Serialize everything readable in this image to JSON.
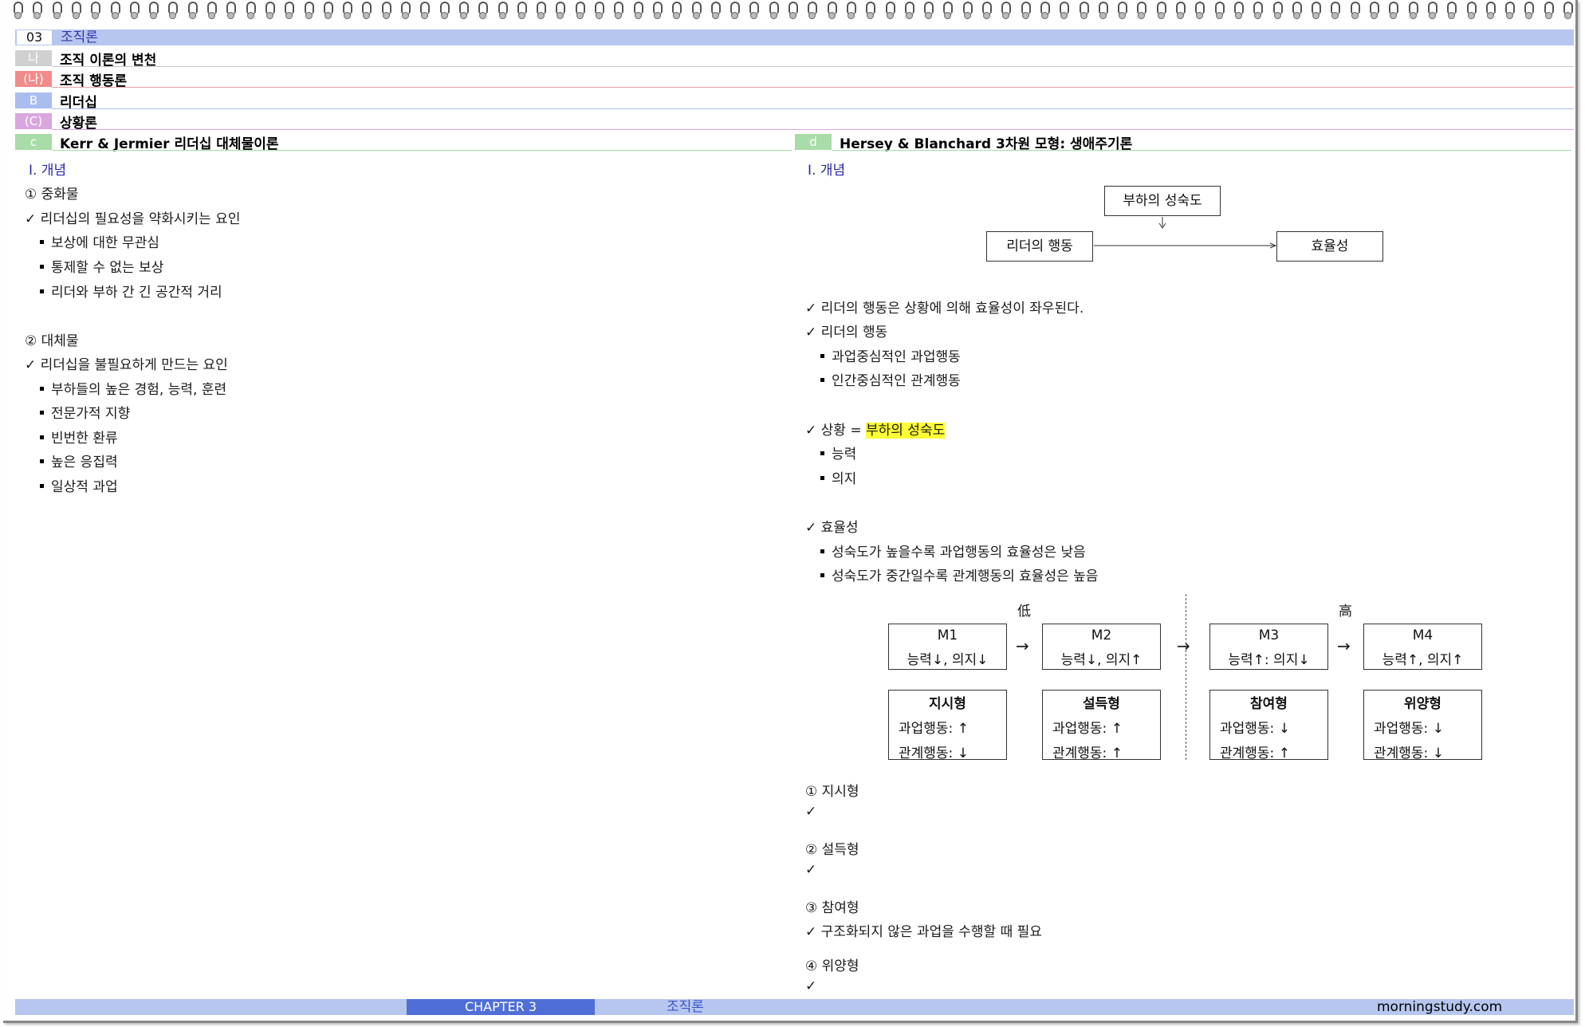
{
  "section": {
    "number": "03",
    "title": "조직론"
  },
  "headers": [
    {
      "tag": "나",
      "title": "조직 이론의 변천",
      "tag_color": "#d0d0d0",
      "line_color": "#c8c8c8"
    },
    {
      "tag": "(나)",
      "title": "조직 행동론",
      "tag_color": "#f28b8b",
      "line_color": "#f2a0a0"
    },
    {
      "tag": "B",
      "title": "리더십",
      "tag_color": "#aabdf0",
      "line_color": "#aabdf0"
    },
    {
      "tag": "(C)",
      "title": "상황론",
      "tag_color": "#d9a6e0",
      "line_color": "#d9a6e0"
    }
  ],
  "left": {
    "tag": "c",
    "title": "Kerr & Jermier 리더십 대체물이론",
    "heading": "Ⅰ. 개념",
    "sub1": "① 중화물",
    "check1": "✓ 리더십의 필요성을 약화시키는 요인",
    "bullets1": [
      "보상에 대한 무관심",
      "통제할 수 없는 보상",
      "리더와 부하 간 긴 공간적 거리"
    ],
    "sub2": "② 대체물",
    "check2": "✓ 리더십을 불필요하게 만드는 요인",
    "bullets2": [
      "부하들의 높은 경험, 능력, 훈련",
      "전문가적 지향",
      "빈번한 환류",
      "높은 응집력",
      "일상적 과업"
    ]
  },
  "right": {
    "tag": "d",
    "title": "Hersey & Blanchard 3차원 모형: 생애주기론",
    "heading": "Ⅰ. 개념",
    "diagram": {
      "top": "부하의 성숙도",
      "left": "리더의 행동",
      "right": "효율성"
    },
    "check1": "✓ 리더의 행동은 상황에 의해 효율성이 좌우된다.",
    "check2": "✓ 리더의 행동",
    "bullets2": [
      "과업중심적인 과업행동",
      "인간중심적인 관계행동"
    ],
    "check3_prefix": "✓ 상황 =",
    "check3_highlight": "부하의 성숙도",
    "bullets3": [
      "능력",
      "의지"
    ],
    "check4": "✓ 효율성",
    "bullets4": [
      "성숙도가 높을수록 과업행동의 효율성은 낮음",
      "성숙도가 중간일수록 관계행동의 효율성은 높음"
    ],
    "low_label": "低",
    "high_label": "高",
    "arrow": "→",
    "maturity": [
      {
        "code": "M1",
        "desc": "능력↓, 의지↓"
      },
      {
        "code": "M2",
        "desc": "능력↓, 의지↑"
      },
      {
        "code": "M3",
        "desc": "능력↑: 의지↓"
      },
      {
        "code": "M4",
        "desc": "능력↑, 의지↑"
      }
    ],
    "styles": [
      {
        "name": "지시형",
        "task": "과업행동: ↑",
        "relation": "관계행동: ↓"
      },
      {
        "name": "설득형",
        "task": "과업행동: ↑",
        "relation": "관계행동: ↑"
      },
      {
        "name": "참여형",
        "task": "과업행동: ↓",
        "relation": "관계행동: ↑"
      },
      {
        "name": "위양형",
        "task": "과업행동: ↓",
        "relation": "관계행동: ↓"
      }
    ],
    "items": [
      {
        "title": "① 지시형",
        "check": "✓"
      },
      {
        "title": "② 설득형",
        "check": "✓"
      },
      {
        "title": "③ 참여형",
        "check": "✓ 구조화되지 않은 과업을 수행할 때 필요"
      },
      {
        "title": "④ 위양형",
        "check": "✓"
      }
    ]
  },
  "footer": {
    "chapter": "CHAPTER 3",
    "title": "조직론",
    "site": "morningstudy.com"
  },
  "colors": {
    "section_bar": "#b7c6ef",
    "green_tag": "#a8dca8",
    "footer_dark": "#4f6fd6",
    "highlight": "#ffff33"
  }
}
